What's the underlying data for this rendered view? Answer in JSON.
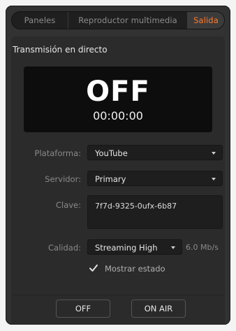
{
  "tabs": [
    {
      "label": "Paneles"
    },
    {
      "label": "Reproductor multimedia"
    },
    {
      "label": "Salida"
    }
  ],
  "section": {
    "title": "Transmisión en directo"
  },
  "status": {
    "state": "OFF",
    "timer": "00:00:00"
  },
  "fields": {
    "platform": {
      "label": "Plataforma:",
      "value": "YouTube"
    },
    "server": {
      "label": "Servidor:",
      "value": "Primary"
    },
    "key": {
      "label": "Clave:",
      "value": "7f7d-9325-0ufx-6b87"
    },
    "quality": {
      "label": "Calidad:",
      "value": "Streaming High",
      "bitrate": "6.0 Mb/s"
    }
  },
  "show_status": {
    "label": "Mostrar estado",
    "checked": true
  },
  "buttons": {
    "off": "OFF",
    "on_air": "ON AIR"
  },
  "colors": {
    "accent": "#ff7a2e",
    "panel": "#323232",
    "display": "#0d0d0d"
  }
}
